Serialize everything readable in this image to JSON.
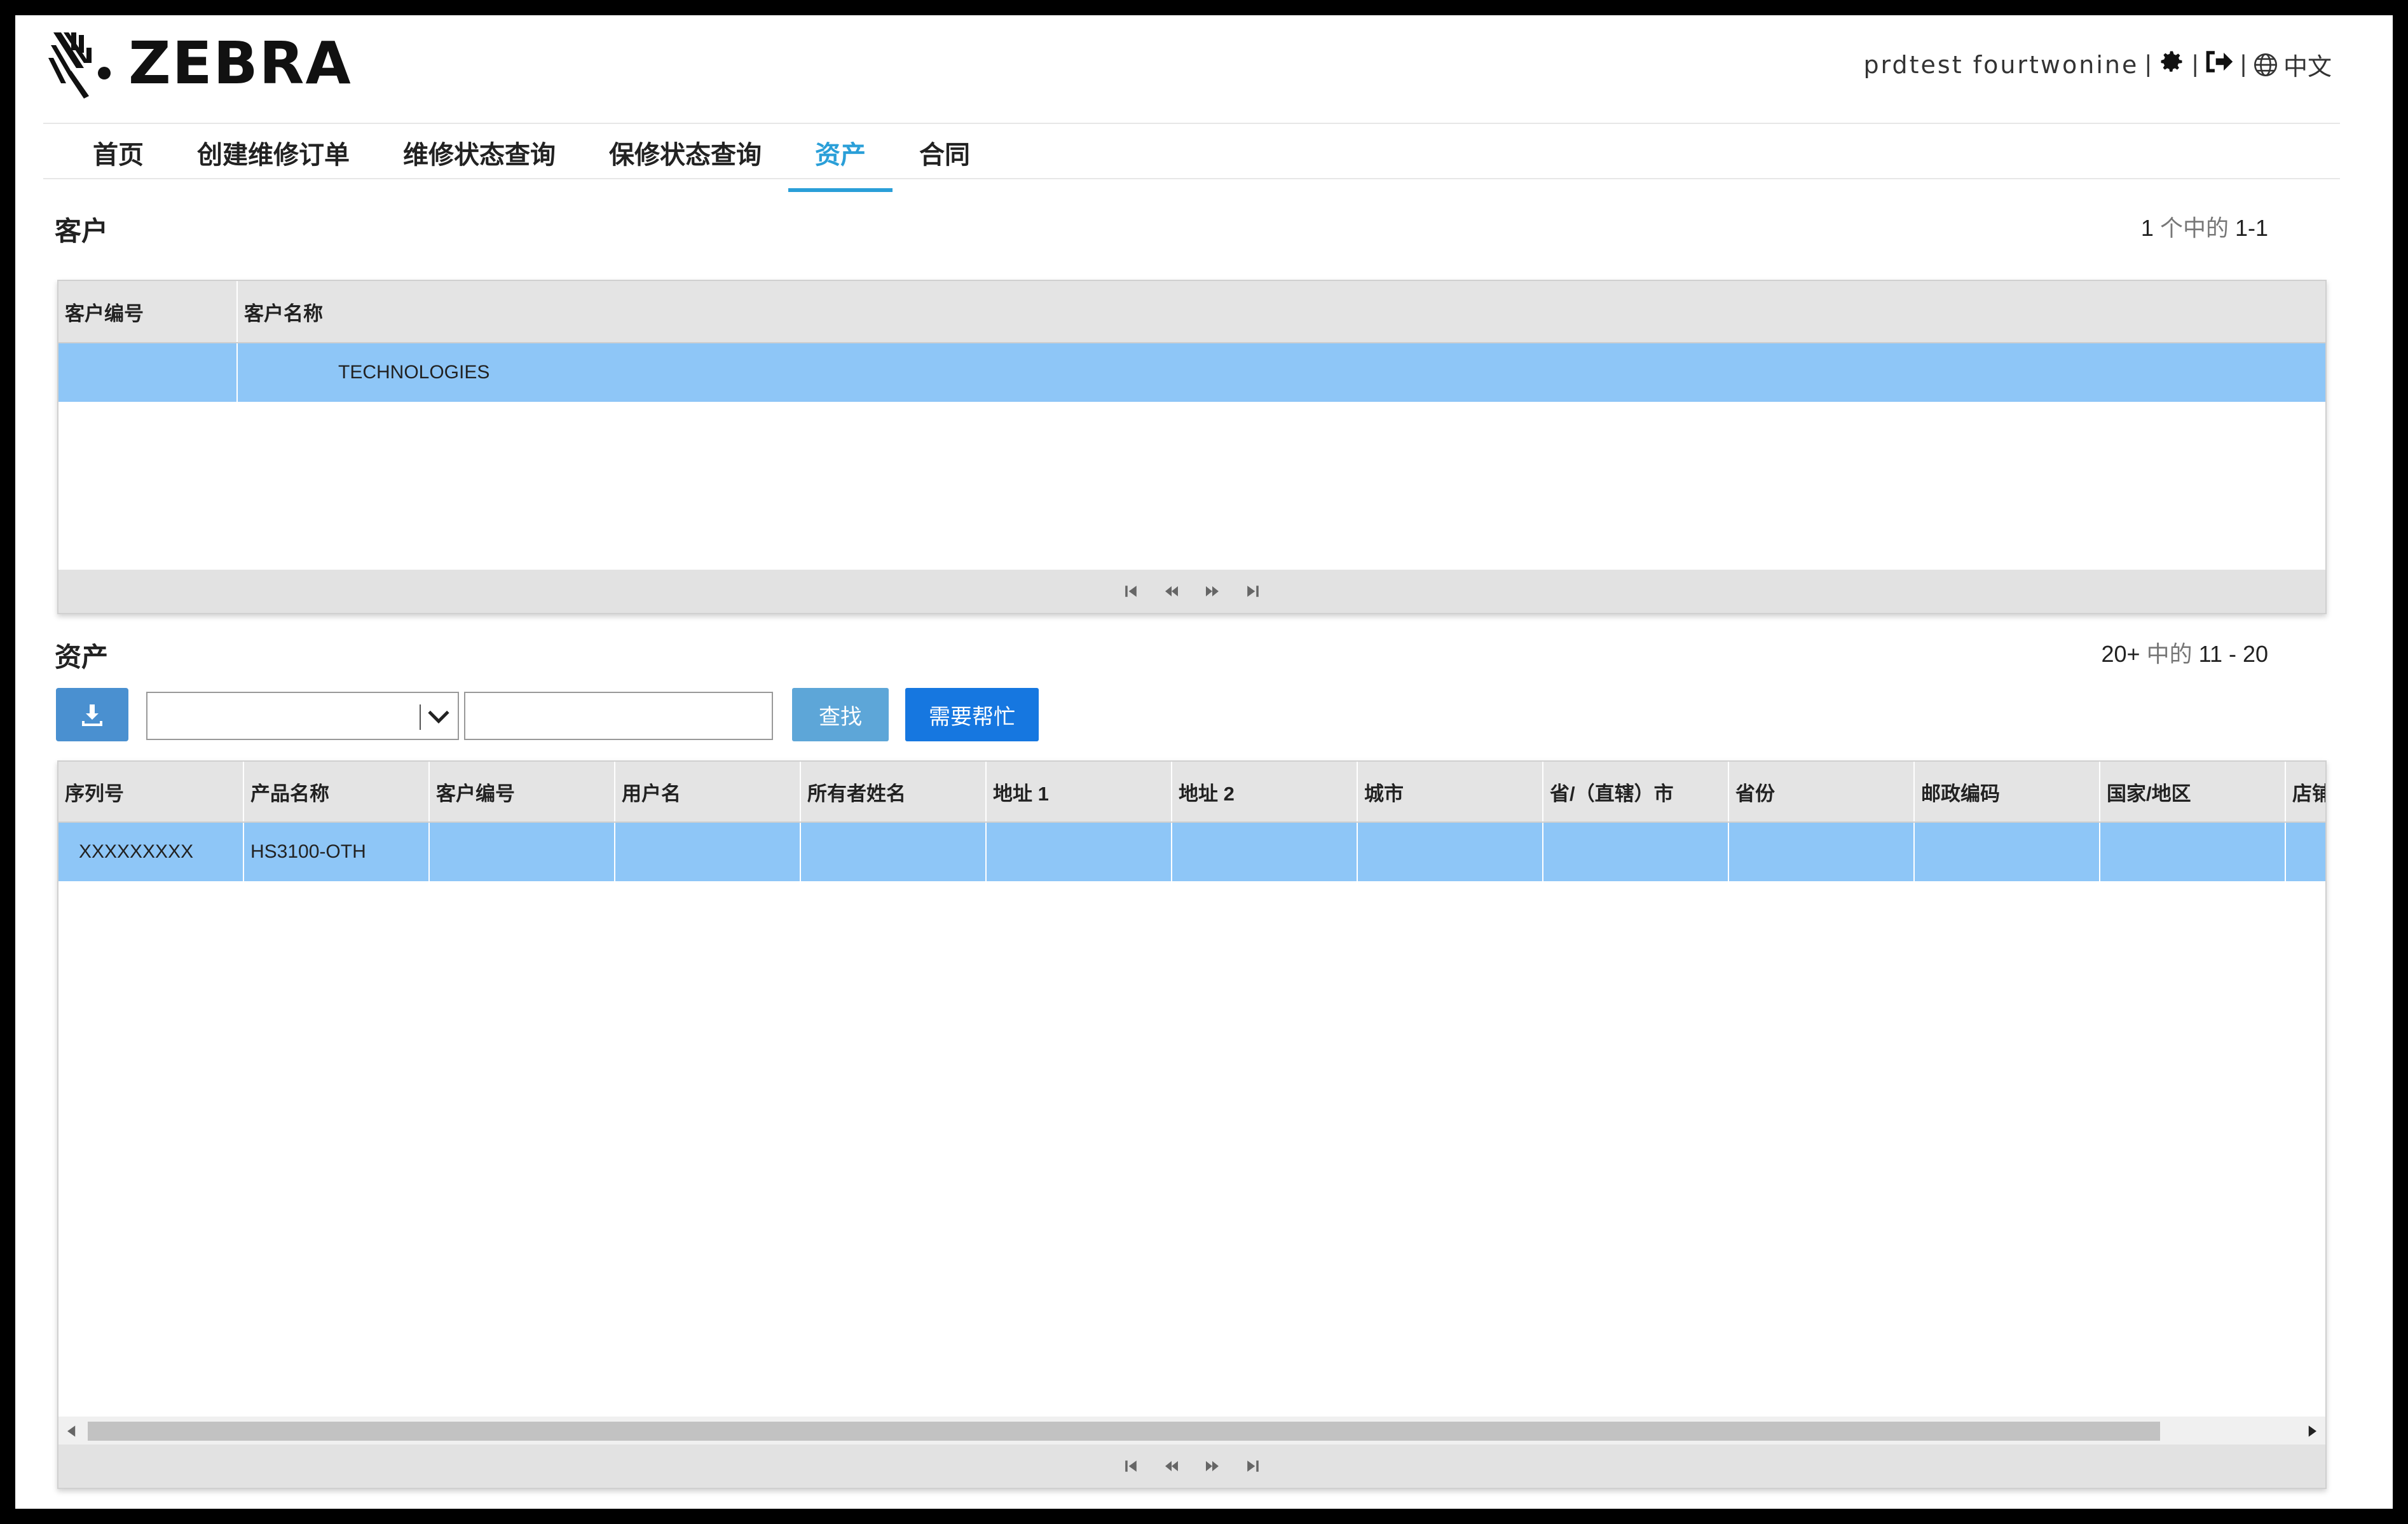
{
  "brand": {
    "name": "ZEBRA"
  },
  "user_bar": {
    "user_name": "prdtest fourtwonine",
    "separator": "|",
    "language": "中文"
  },
  "nav": {
    "items": [
      {
        "label": "首页"
      },
      {
        "label": "创建维修订单"
      },
      {
        "label": "维修状态查询"
      },
      {
        "label": "保修状态查询"
      },
      {
        "label": "资产",
        "active": true
      },
      {
        "label": "合同"
      }
    ]
  },
  "customer_section": {
    "title": "客户",
    "pager_count": "1",
    "pager_of": "个中的",
    "pager_range": "1-1",
    "columns": [
      "客户编号",
      "客户名称"
    ],
    "rows": [
      {
        "customer_id": "",
        "customer_name": "TECHNOLOGIES",
        "selected": true
      }
    ]
  },
  "asset_section": {
    "title": "资产",
    "pager_count": "20+",
    "pager_of": "中的",
    "pager_range": "11 - 20",
    "filter_select_value": "",
    "search_value": "",
    "find_label": "查找",
    "help_label": "需要帮忙",
    "columns": [
      "序列号",
      "产品名称",
      "客户编号",
      "用户名",
      "所有者姓名",
      "地址 1",
      "地址 2",
      "城市",
      "省/（直辖）市",
      "省份",
      "邮政编码",
      "国家/地区",
      "店铺"
    ],
    "rows": [
      {
        "cells": [
          "XXXXXXXXX",
          "HS3100-OTH",
          "",
          "",
          "",
          "",
          "",
          "",
          "",
          "",
          "",
          "",
          ""
        ],
        "selected": true
      }
    ]
  },
  "colors": {
    "accent": "#2a9fd8",
    "selected_row": "#8ec6f7",
    "primary_button": "#1677e0",
    "secondary_button": "#5da6d8"
  },
  "icons": [
    "zebra-logo-icon",
    "gear-icon",
    "sign-out-icon",
    "globe-icon",
    "download-icon",
    "chevron-down-icon",
    "first-page-icon",
    "prev-page-icon",
    "next-page-icon",
    "last-page-icon"
  ]
}
